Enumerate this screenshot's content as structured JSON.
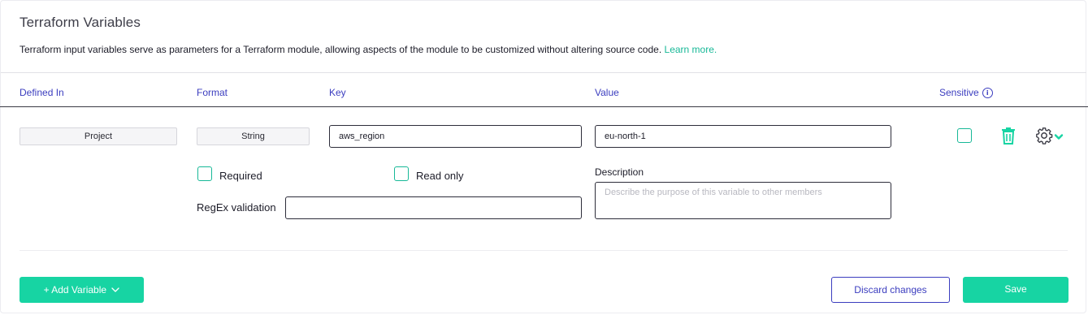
{
  "header": {
    "title": "Terraform Variables",
    "description": "Terraform input variables serve as parameters for a Terraform module, allowing aspects of the module to be customized without altering source code.",
    "learn_more": "Learn more."
  },
  "table": {
    "columns": {
      "defined_in": "Defined In",
      "format": "Format",
      "key": "Key",
      "value": "Value",
      "sensitive": "Sensitive"
    },
    "row": {
      "defined_in": "Project",
      "format": "String",
      "key": "aws_region",
      "value": "eu-north-1",
      "sensitive": false,
      "required_label": "Required",
      "required": false,
      "read_only_label": "Read only",
      "read_only": false,
      "regex_label": "RegEx validation",
      "regex_value": "",
      "description_label": "Description",
      "description_placeholder": "Describe the purpose of this variable to other members"
    }
  },
  "footer": {
    "add_variable": "+ Add Variable",
    "discard": "Discard changes",
    "save": "Save"
  },
  "icons": {
    "info": "info-icon",
    "trash": "trash-icon",
    "gear": "gear-icon",
    "chevron": "chevron-down-icon"
  },
  "colors": {
    "accent_green": "#17d4a3",
    "link_green": "#17b897",
    "header_blue": "#3b3dbf"
  }
}
